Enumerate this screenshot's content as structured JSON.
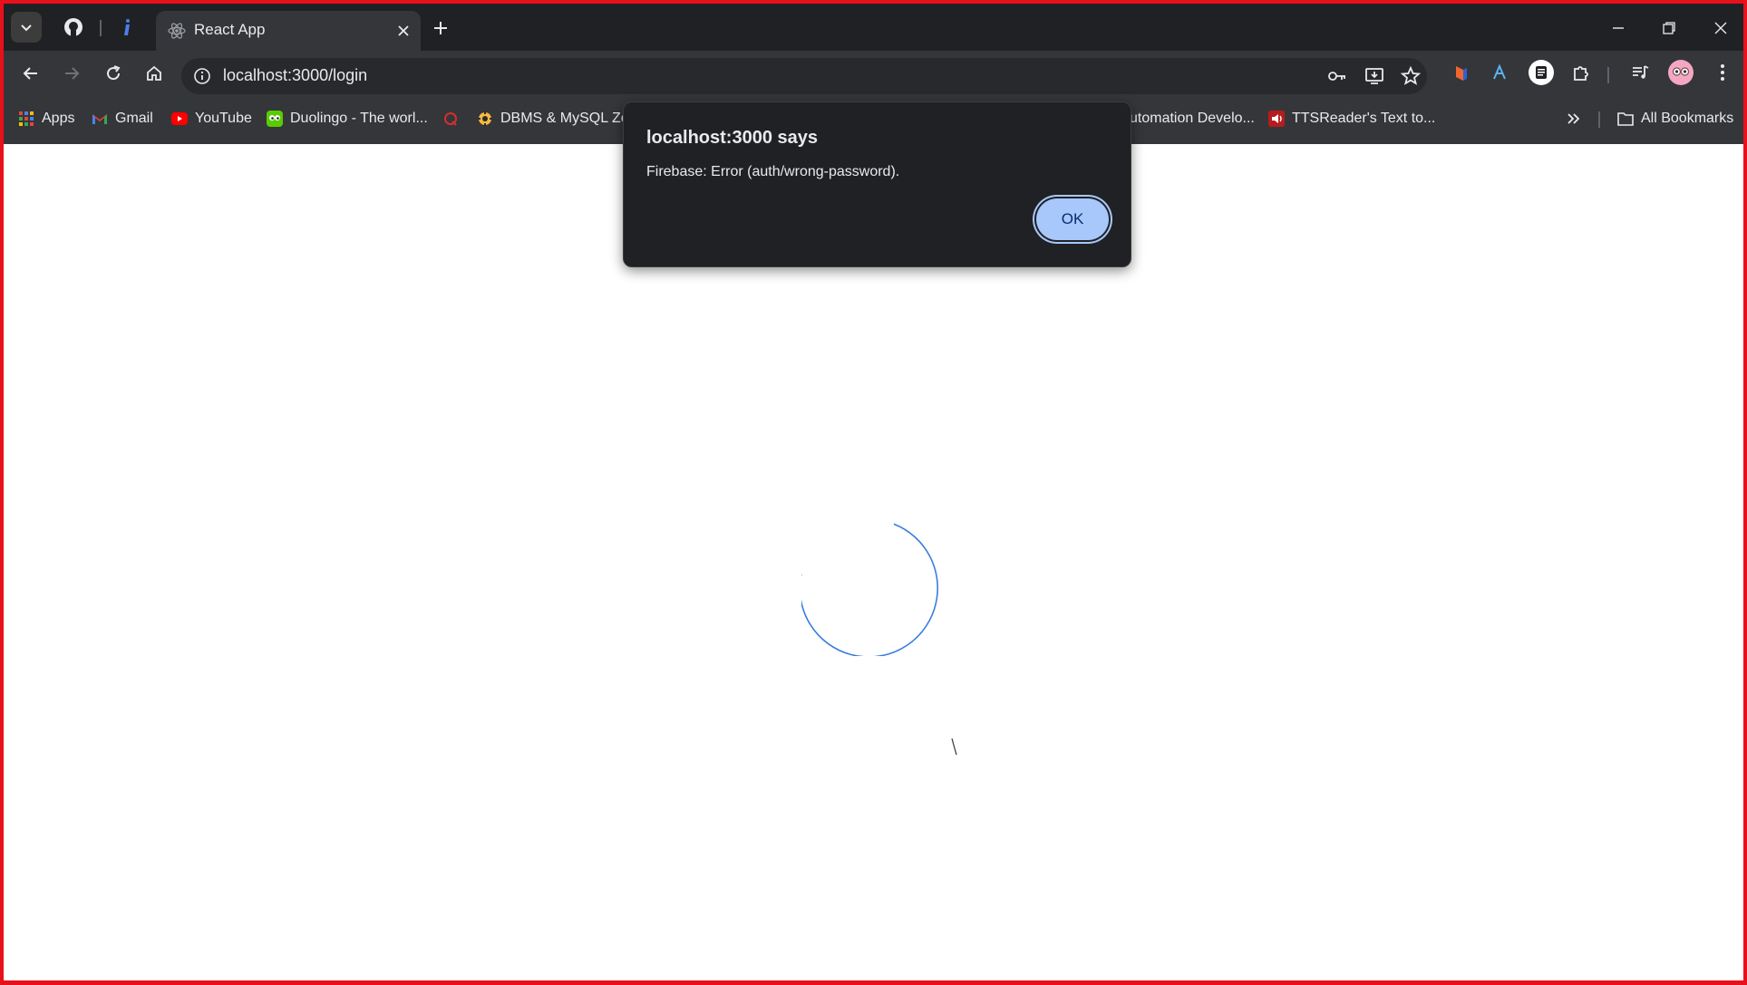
{
  "browser": {
    "tab": {
      "title": "React App",
      "icon": "react-icon"
    },
    "address_bar": {
      "url": "localhost:3000/login"
    },
    "bookmarks": [
      {
        "label": "Apps",
        "icon": "apps-grid-icon"
      },
      {
        "label": "Gmail",
        "icon": "gmail-icon"
      },
      {
        "label": "YouTube",
        "icon": "youtube-icon"
      },
      {
        "label": "Duolingo - The worl...",
        "icon": "duolingo-icon"
      },
      {
        "label": "",
        "icon": "quora-icon"
      },
      {
        "label": "DBMS & MySQL Zer",
        "icon": "dbms-icon"
      },
      {
        "label": "utomation Develo...",
        "icon": ""
      },
      {
        "label": "TTSReader's Text to...",
        "icon": "ttsreader-icon"
      }
    ],
    "all_bookmarks_label": "All Bookmarks"
  },
  "alert": {
    "title": "localhost:3000 says",
    "message": "Firebase: Error (auth/wrong-password).",
    "ok_label": "OK"
  },
  "colors": {
    "frame_border": "#e8101a",
    "spinner": "#3b7ddd",
    "ok_button": "#a8c7fa"
  }
}
